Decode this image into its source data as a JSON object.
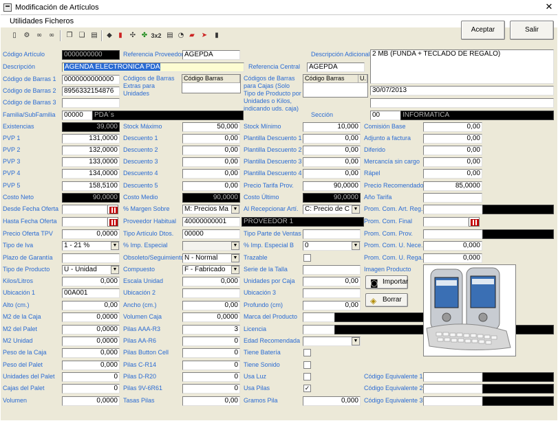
{
  "window": {
    "title": "Modificación de Artículos",
    "close": "✕"
  },
  "menu": [
    "Utilidades",
    "Ficheros"
  ],
  "buttons": {
    "accept": "Aceptar",
    "exit": "Salir",
    "import": "Importar",
    "delete": "Borrar"
  },
  "toolbar": {
    "multiply": "3x2"
  },
  "fields": {
    "codigo_articulo": {
      "label": "Código Artículo",
      "value": "0000000000"
    },
    "ref_proveedor": {
      "label": "Referencia Proveedor",
      "value": "AGEPDA"
    },
    "desc_adicional": {
      "label": "Descripción Adicional",
      "value": "2 MB (FUNDA + TECLADO DE REGALO)"
    },
    "descripcion": {
      "label": "Descripción",
      "value": "AGENDA ELECTRONICA PDA"
    },
    "ref_central": {
      "label": "Referencia Central",
      "value": "AGEPDA"
    },
    "cb1": {
      "label": "Código de Barras 1",
      "value": "0000000000000"
    },
    "cb_extras": {
      "label": "Códigos de Barras Extras para Unidades",
      "header": "Código Barras"
    },
    "cb_cajas": {
      "label": "Códigos de Barras para Cajas (Solo Tipo de Producto por Unidades o Kilos, indicando uds. caja)",
      "header1": "Código Barras",
      "header2": "U."
    },
    "cb2": {
      "label": "Código de Barras 2",
      "value": "8956332154876"
    },
    "date": "30/07/2013",
    "cb3": {
      "label": "Código de Barras 3",
      "value": ""
    },
    "familia": {
      "label": "Familia/SubFamilia",
      "code": "00000",
      "name": "PDA´s"
    },
    "seccion": {
      "label": "Sección",
      "code": "00",
      "name": "INFORMATICA"
    }
  },
  "grid": [
    {
      "l1": "Existencias",
      "v1": "39,000",
      "l2": "Stock Máximo",
      "v2": "50,000",
      "l3": "Stock Mínimo",
      "v3": "10,000",
      "l4": "Comisión Base",
      "v4": "0,00"
    },
    {
      "l1": "PVP 1",
      "v1": "131,0000",
      "l2": "Descuento 1",
      "v2": "0,00",
      "l3": "Plantilla Descuento 1",
      "v3": "0,00",
      "l4": "Adjunto a factura",
      "v4": "0,00"
    },
    {
      "l1": "PVP 2",
      "v1": "132,0000",
      "l2": "Descuento 2",
      "v2": "0,00",
      "l3": "Plantilla Descuento 2",
      "v3": "0,00",
      "l4": "Diferido",
      "v4": "0,00"
    },
    {
      "l1": "PVP 3",
      "v1": "133,0000",
      "l2": "Descuento 3",
      "v2": "0,00",
      "l3": "Plantilla Descuento 3",
      "v3": "0,00",
      "l4": "Mercancía sin cargo",
      "v4": "0,00"
    },
    {
      "l1": "PVP 4",
      "v1": "134,0000",
      "l2": "Descuento 4",
      "v2": "0,00",
      "l3": "Plantilla Descuento 4",
      "v3": "0,00",
      "l4": "Rápel",
      "v4": "0,00"
    },
    {
      "l1": "PVP 5",
      "v1": "158,5100",
      "l2": "Descuento 5",
      "v2": "0,00",
      "l3": "Precio Tarifa Prov.",
      "v3": "90,0000",
      "l4": "Precio Recomendado",
      "v4": "85,0000"
    },
    {
      "l1": "Costo Neto",
      "v1": "90,0000",
      "l2": "Costo Medio",
      "v2": "90,0000",
      "l3": "Costo Último",
      "v3": "90,0000",
      "l4": "Año Tarifa",
      "v4": ""
    }
  ],
  "rows": {
    "desde_oferta": "Desde Fecha Oferta",
    "margen": "% Margen Sobre",
    "margen_val": "M: Precios Ma",
    "recepcionar": "Al Recepcionar Artí.",
    "recep_val": "C: Precio de C",
    "prom_art_reg": "Prom. Com. Art. Reg.",
    "hasta_oferta": "Hasta Fecha Oferta",
    "prov_habitual": "Proveedor Habitual",
    "prov_code": "40000000001",
    "prov_name": "PROVEEDOR 1",
    "prom_final": "Prom. Com. Final",
    "precio_oferta": "Precio Oferta TPV",
    "precio_oferta_val": "0,0000",
    "tipo_dtos": "Tipo Artículo Dtos.",
    "tipo_dtos_val": "00000",
    "tipo_parte": "Tipo Parte de Ventas",
    "prom_prov": "Prom. Com. Prov.",
    "tipo_iva": "Tipo de Iva",
    "tipo_iva_val": "1 - 21 %",
    "imp_especial": "% Imp. Especial",
    "imp_especial_b": "% Imp. Especial B",
    "imp_b_val": "0",
    "prom_u_nece": "Prom. Com. U. Nece.",
    "prom_u_nece_val": "0,000",
    "plazo": "Plazo de Garantía",
    "obsoleto": "Obsoleto/Seguimiento",
    "obsoleto_val": "N - Normal",
    "trazable": "Trazable",
    "prom_u_rega": "Prom. Com. U. Rega.",
    "prom_u_rega_val": "0,000",
    "tipo_producto": "Tipo de Producto",
    "tipo_producto_val": "U - Unidad",
    "compuesto": "Compuesto",
    "compuesto_val": "F - Fabricado",
    "serie_talla": "Serie de la Talla",
    "imagen": "Imagen Producto",
    "kilos": "Kilos/Litros",
    "kilos_val": "0,000",
    "escala": "Escala Unidad",
    "escala_val": "0,000",
    "uds_caja": "Unidades por Caja",
    "uds_caja_val": "0,00",
    "ubic1": "Ubicación 1",
    "ubic1_val": "00A001",
    "ubic2": "Ubicación 2",
    "ubic3": "Ubicación 3",
    "alto": "Alto (cm.)",
    "alto_val": "0,00",
    "ancho": "Ancho (cm.)",
    "ancho_val": "0,00",
    "profundo": "Profundo (cm)",
    "profundo_val": "0,00",
    "m2_caja": "M2 de la Caja",
    "m2_caja_val": "0,0000",
    "vol_caja": "Volumen Caja",
    "vol_caja_val": "0,0000",
    "marca": "Marca del Producto",
    "m2_palet": "M2 del Palet",
    "m2_palet_val": "0,0000",
    "pilas_aaa": "Pilas AAA-R3",
    "pilas_aaa_val": "3",
    "licencia": "Licencia",
    "m2_unidad": "M2 Unidad",
    "m2_unidad_val": "0,0000",
    "pilas_aa": "Pilas AA-R6",
    "pilas_aa_val": "0",
    "edad": "Edad Recomendada",
    "peso_caja": "Peso de la Caja",
    "peso_caja_val": "0,000",
    "pilas_button": "Pilas Button Cell",
    "pilas_button_val": "0",
    "tiene_bateria": "Tiene Batería",
    "peso_palet": "Peso del Palet",
    "peso_palet_val": "0,000",
    "pilas_c": "Pilas C-R14",
    "pilas_c_val": "0",
    "tiene_sonido": "Tiene Sonido",
    "uds_palet": "Unidades del Palet",
    "uds_palet_val": "0",
    "pilas_d": "Pilas D-R20",
    "pilas_d_val": "0",
    "usa_luz": "Usa Luz",
    "cod_eq1": "Código Equivalente 1",
    "cajas_palet": "Cajas del Palet",
    "cajas_palet_val": "0",
    "pilas_9v": "Pilas 9V-6R61",
    "pilas_9v_val": "0",
    "usa_pilas": "Usa Pilas",
    "cod_eq2": "Código Equivalente 2",
    "volumen": "Volumen",
    "volumen_val": "0,0000",
    "tasas": "Tasas Pilas",
    "tasas_val": "0,00",
    "gramos": "Gramos Pila",
    "gramos_val": "0,000",
    "cod_eq3": "Código Equivalente 3"
  },
  "checks": {
    "usa_pilas": "✓"
  }
}
